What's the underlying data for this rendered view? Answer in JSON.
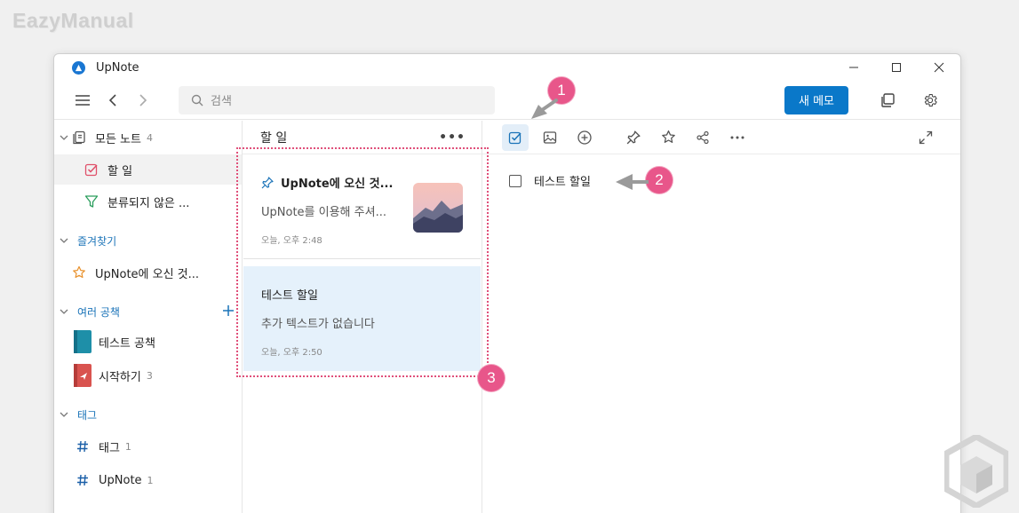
{
  "watermark": "EazyManual",
  "window": {
    "title": "UpNote",
    "controls": {
      "minimize": "—",
      "maximize": "☐",
      "close": "✕"
    }
  },
  "toolbar": {
    "search_placeholder": "검색",
    "new_memo_label": "새 메모"
  },
  "sidebar": {
    "all_notes": {
      "label": "모든 노트",
      "count": "4"
    },
    "todo": {
      "label": "할 일"
    },
    "uncategorized": {
      "label": "분류되지 않은 ..."
    },
    "favorites_header": "즐겨찾기",
    "favorite_item": {
      "label": "UpNote에 오신 것..."
    },
    "notebooks_header": "여러 공책",
    "notebooks": [
      {
        "label": "테스트 공책",
        "count": "",
        "color": "#1e8fa8"
      },
      {
        "label": "시작하기",
        "count": "3",
        "color": "#d9534f"
      }
    ],
    "tags_header": "태그",
    "tags": [
      {
        "label": "태그",
        "count": "1"
      },
      {
        "label": "UpNote",
        "count": "1"
      }
    ]
  },
  "note_list": {
    "header": "할 일",
    "more": "•••",
    "notes": [
      {
        "title": "UpNote에 오신 것...",
        "preview": "UpNote를 이용해 주셔...",
        "time": "오늘, 오후 2:48"
      },
      {
        "title": "테스트 할일",
        "preview": "추가 텍스트가 없습니다",
        "time": "오늘, 오후 2:50"
      }
    ]
  },
  "editor": {
    "todo_item": "테스트 할일"
  },
  "annotations": {
    "badge1": "1",
    "badge2": "2",
    "badge3": "3"
  },
  "colors": {
    "accent": "#0a78c9",
    "badge": "#e8568a",
    "selected_note_bg": "#e5f1fb"
  }
}
